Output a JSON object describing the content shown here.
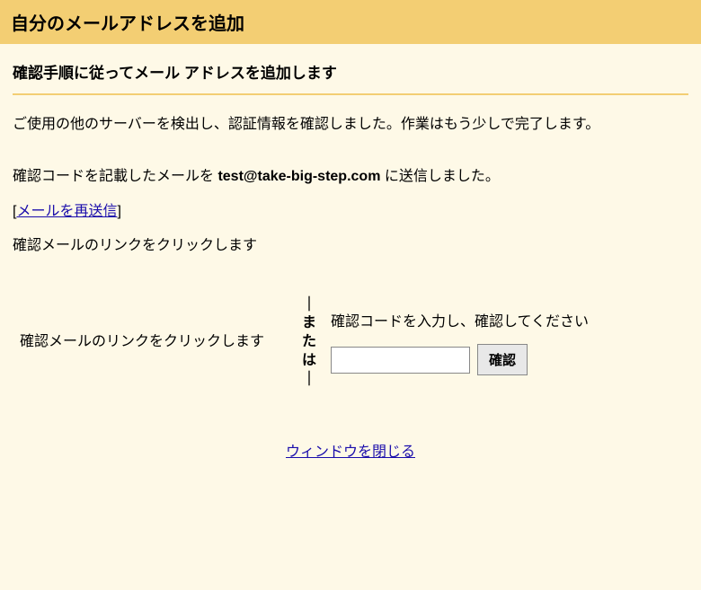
{
  "header": {
    "title": "自分のメールアドレスを追加"
  },
  "subtitle": "確認手順に従ってメール アドレスを追加します",
  "body": {
    "line1": "ご使用の他のサーバーを検出し、認証情報を確認しました。作業はもう少しで完了します。",
    "line2_prefix": "確認コードを記載したメールを ",
    "email": "test@take-big-step.com",
    "line2_suffix": " に送信しました。",
    "resend_link": "メールを再送信",
    "line3": "確認メールのリンクをクリックします"
  },
  "verify": {
    "left": "確認メールのリンクをクリックします",
    "divider": {
      "top": "｜",
      "m": "ま",
      "t": "た",
      "h": "は",
      "bottom": "｜"
    },
    "right": {
      "prompt": "確認コードを入力し、確認してください",
      "button": "確認"
    }
  },
  "footer": {
    "close": "ウィンドウを閉じる"
  }
}
